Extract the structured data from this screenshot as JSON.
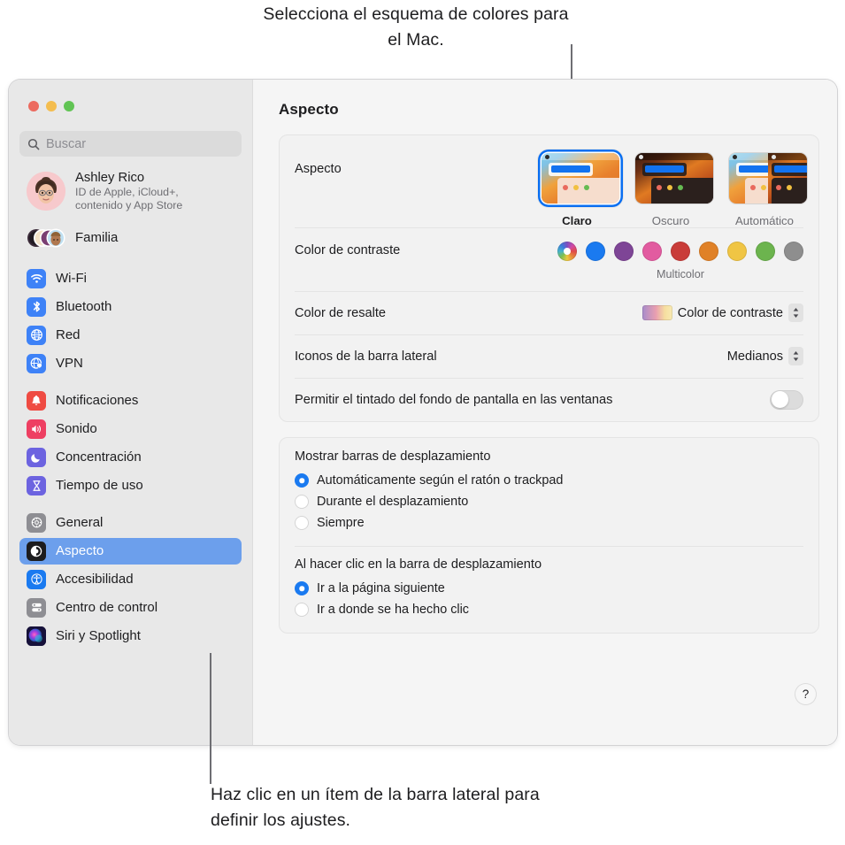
{
  "callouts": {
    "top": "Selecciona el esquema de colores para el Mac.",
    "bottom": "Haz clic en un ítem de la barra lateral para definir los ajustes."
  },
  "window": {
    "traffic_lights": [
      "close",
      "minimize",
      "zoom"
    ]
  },
  "sidebar": {
    "search": {
      "placeholder": "Buscar",
      "value": ""
    },
    "account": {
      "name": "Ashley Rico",
      "subtitle_line1": "ID de Apple, iCloud+,",
      "subtitle_line2": "contenido y App Store"
    },
    "family": {
      "label": "Familia"
    },
    "groups": [
      {
        "items": [
          {
            "label": "Wi-Fi",
            "icon": "wifi-icon",
            "color": "#3e82f7",
            "selected": false
          },
          {
            "label": "Bluetooth",
            "icon": "bluetooth-icon",
            "color": "#3e82f7",
            "selected": false
          },
          {
            "label": "Red",
            "icon": "globe-icon",
            "color": "#3e82f7",
            "selected": false
          },
          {
            "label": "VPN",
            "icon": "vpn-globe-icon",
            "color": "#3e82f7",
            "selected": false
          }
        ]
      },
      {
        "items": [
          {
            "label": "Notificaciones",
            "icon": "bell-icon",
            "color": "#ef4b42",
            "selected": false
          },
          {
            "label": "Sonido",
            "icon": "speaker-icon",
            "color": "#ee3f62",
            "selected": false
          },
          {
            "label": "Concentración",
            "icon": "moon-icon",
            "color": "#6c63e0",
            "selected": false
          },
          {
            "label": "Tiempo de uso",
            "icon": "hourglass-icon",
            "color": "#6c63e0",
            "selected": false
          }
        ]
      },
      {
        "items": [
          {
            "label": "General",
            "icon": "gear-icon",
            "color": "#8e8e93",
            "selected": false
          },
          {
            "label": "Aspecto",
            "icon": "appearance-icon",
            "color": "#1c1c1e",
            "selected": true
          },
          {
            "label": "Accesibilidad",
            "icon": "accessibility-icon",
            "color": "#1a7af0",
            "selected": false
          },
          {
            "label": "Centro de control",
            "icon": "control-center-icon",
            "color": "#8e8e93",
            "selected": false
          },
          {
            "label": "Siri y Spotlight",
            "icon": "siri-icon",
            "color": "#2b2b4a",
            "selected": false
          }
        ]
      }
    ]
  },
  "main": {
    "title": "Aspecto",
    "appearance": {
      "label": "Aspecto",
      "options": [
        {
          "label": "Claro",
          "value": "light",
          "selected": true
        },
        {
          "label": "Oscuro",
          "value": "dark",
          "selected": false
        },
        {
          "label": "Automático",
          "value": "auto",
          "selected": false
        }
      ]
    },
    "contrast_color": {
      "label": "Color de contraste",
      "caption": "Multicolor",
      "swatches": [
        {
          "name": "Multicolor",
          "color": "multicolor",
          "selected": true
        },
        {
          "name": "Azul",
          "color": "#1a7af0",
          "selected": false
        },
        {
          "name": "Morado",
          "color": "#7e4596",
          "selected": false
        },
        {
          "name": "Rosa",
          "color": "#e25ba0",
          "selected": false
        },
        {
          "name": "Rojo",
          "color": "#c93c39",
          "selected": false
        },
        {
          "name": "Naranja",
          "color": "#e08127",
          "selected": false
        },
        {
          "name": "Amarillo",
          "color": "#f0c544",
          "selected": false
        },
        {
          "name": "Verde",
          "color": "#6cb44e",
          "selected": false
        },
        {
          "name": "Grafito",
          "color": "#8e8e8e",
          "selected": false
        }
      ]
    },
    "highlight_color": {
      "label": "Color de resalte",
      "value": "Color de contraste"
    },
    "sidebar_icon_size": {
      "label": "Iconos de la barra lateral",
      "value": "Medianos"
    },
    "wallpaper_tinting": {
      "label": "Permitir el tintado del fondo de pantalla en las ventanas",
      "on": false
    },
    "show_scrollbars": {
      "title": "Mostrar barras de desplazamiento",
      "options": [
        {
          "label": "Automáticamente según el ratón o trackpad",
          "selected": true
        },
        {
          "label": "Durante el desplazamiento",
          "selected": false
        },
        {
          "label": "Siempre",
          "selected": false
        }
      ]
    },
    "click_scrollbar": {
      "title": "Al hacer clic en la barra de desplazamiento",
      "options": [
        {
          "label": "Ir a la página siguiente",
          "selected": true
        },
        {
          "label": "Ir a donde se ha hecho clic",
          "selected": false
        }
      ]
    },
    "help": {
      "label": "?"
    }
  },
  "colors": {
    "accent": "#1a7af0",
    "sidebar_selection": "#6c9fec",
    "window_bg": "#f5f5f5",
    "sidebar_bg": "#e8e8e8"
  }
}
